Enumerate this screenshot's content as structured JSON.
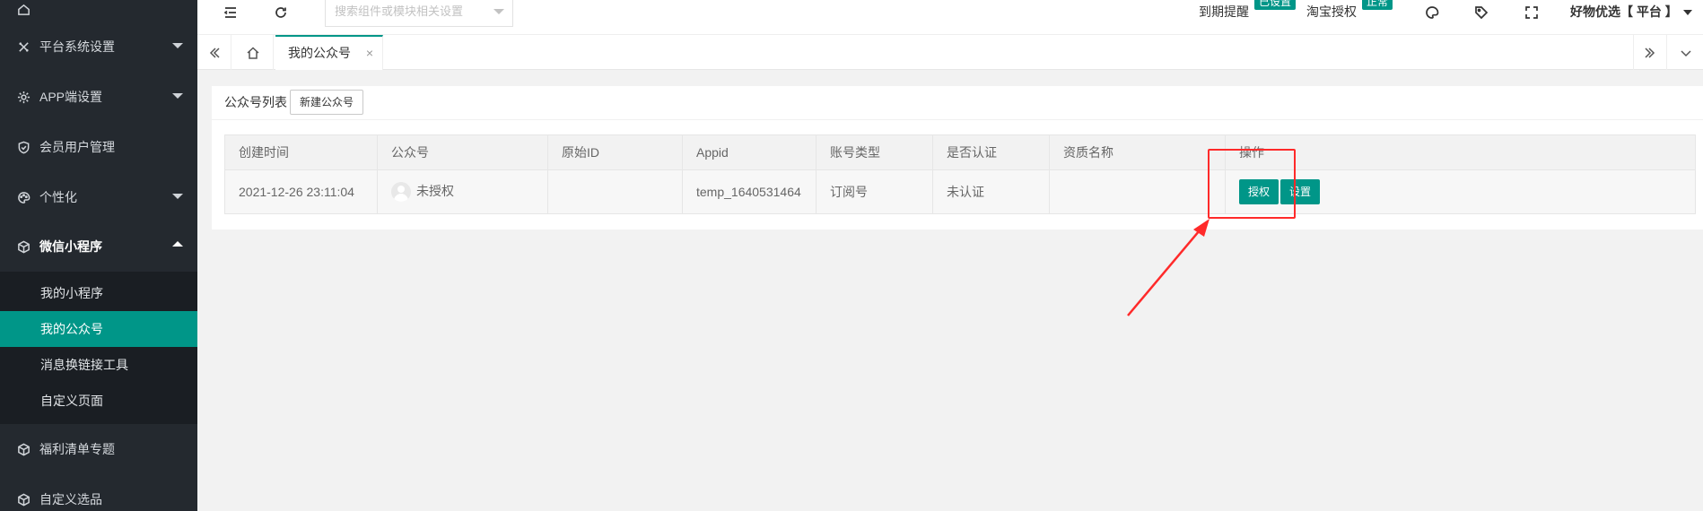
{
  "sidebar": {
    "items": [
      {
        "label": "平台系统设置",
        "icon": "tools-icon"
      },
      {
        "label": "APP端设置",
        "icon": "gear-icon"
      },
      {
        "label": "会员用户管理",
        "icon": "shield-icon"
      },
      {
        "label": "个性化",
        "icon": "palette-icon"
      },
      {
        "label": "微信小程序",
        "icon": "cube-icon"
      },
      {
        "label": "福利清单专题",
        "icon": "cube-icon"
      },
      {
        "label": "自定义选品",
        "icon": "cube-icon"
      }
    ],
    "subitems": [
      {
        "label": "我的小程序"
      },
      {
        "label": "我的公众号"
      },
      {
        "label": "消息换链接工具"
      },
      {
        "label": "自定义页面"
      }
    ]
  },
  "header": {
    "search_placeholder": "搜索组件或模块相关设置",
    "expiry_label": "到期提醒",
    "expiry_badge": "已设置",
    "taobao_label": "淘宝授权",
    "taobao_badge": "正常",
    "user_label": "好物优选【 平台 】"
  },
  "tabs": {
    "active_label": "我的公众号",
    "close_glyph": "×"
  },
  "card": {
    "title": "公众号列表",
    "new_button": "新建公众号"
  },
  "table": {
    "headers": [
      "创建时间",
      "公众号",
      "原始ID",
      "Appid",
      "账号类型",
      "是否认证",
      "资质名称",
      "操作"
    ],
    "rows": [
      {
        "created": "2021-12-26 23:11:04",
        "account": "未授权",
        "original_id": "",
        "appid": "temp_1640531464",
        "type": "订阅号",
        "verified": "未认证",
        "qualification": "",
        "actions": [
          "授权",
          "设置"
        ]
      }
    ]
  },
  "colors": {
    "accent": "#009688",
    "sidebar_bg": "#24292f",
    "highlight": "#ff2a2a"
  }
}
